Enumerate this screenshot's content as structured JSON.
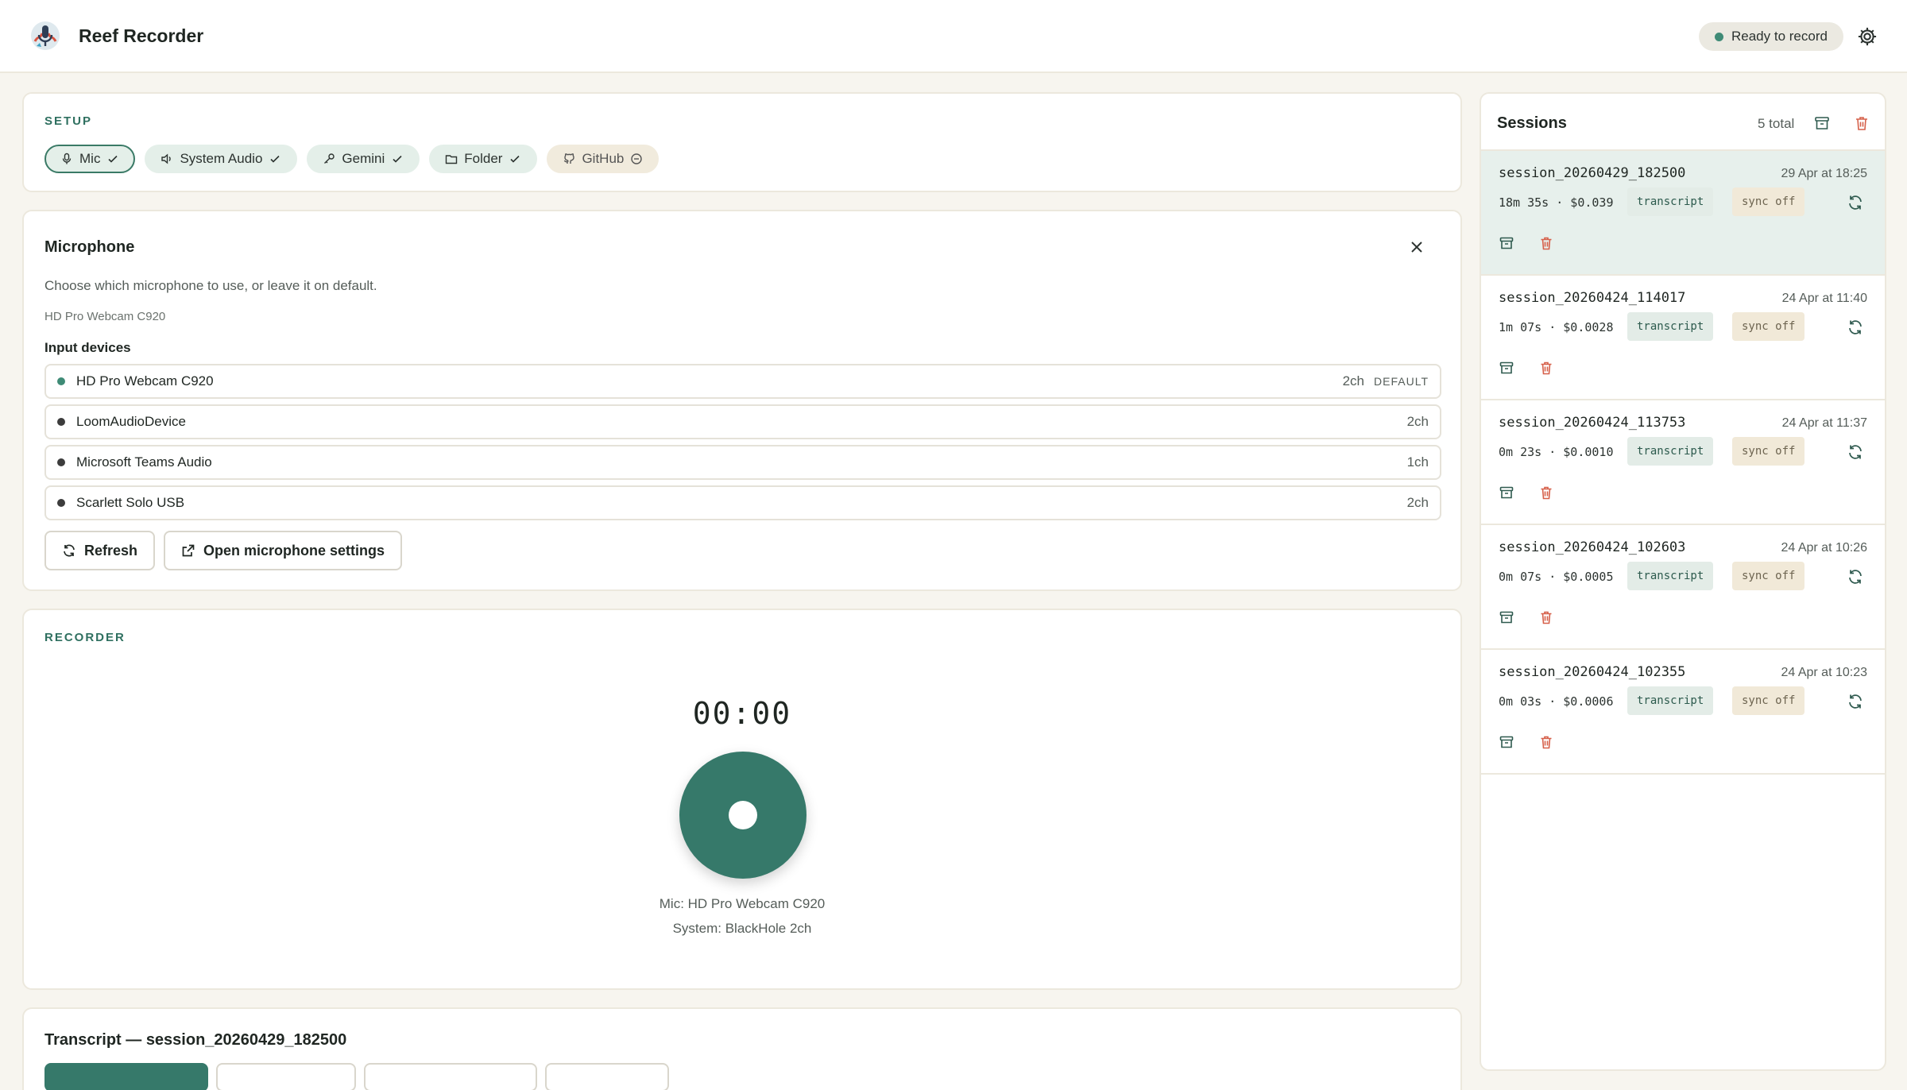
{
  "header": {
    "app_title": "Reef Recorder",
    "status": "Ready to record",
    "accent": "#36796a"
  },
  "setup": {
    "label": "SETUP",
    "chips": [
      {
        "label": "Mic",
        "icon": "mic-icon",
        "state": "check",
        "active": true
      },
      {
        "label": "System Audio",
        "icon": "speaker-icon",
        "state": "check"
      },
      {
        "label": "Gemini",
        "icon": "key-icon",
        "state": "check"
      },
      {
        "label": "Folder",
        "icon": "folder-icon",
        "state": "check"
      },
      {
        "label": "GitHub",
        "icon": "github-icon",
        "state": "minus"
      }
    ]
  },
  "microphone": {
    "title": "Microphone",
    "description": "Choose which microphone to use, or leave it on default.",
    "current": "HD Pro Webcam C920",
    "input_label": "Input devices",
    "devices": [
      {
        "name": "HD Pro Webcam C920",
        "channels": "2ch",
        "badge": "DEFAULT",
        "selected": true
      },
      {
        "name": "LoomAudioDevice",
        "channels": "2ch"
      },
      {
        "name": "Microsoft Teams Audio",
        "channels": "1ch"
      },
      {
        "name": "Scarlett Solo USB",
        "channels": "2ch"
      }
    ],
    "refresh_label": "Refresh",
    "settings_label": "Open microphone settings"
  },
  "recorder": {
    "label": "RECORDER",
    "timer": "00:00",
    "mic_line": "Mic: HD Pro Webcam C920",
    "system_line": "System: BlackHole 2ch"
  },
  "transcript": {
    "title": "Transcript — session_20260429_182500"
  },
  "sessions": {
    "title": "Sessions",
    "count": "5 total",
    "items": [
      {
        "name": "session_20260429_182500",
        "date": "29 Apr at 18:25",
        "meta": "18m 35s · $0.039",
        "tag": "transcript",
        "sync": "sync off",
        "active": true
      },
      {
        "name": "session_20260424_114017",
        "date": "24 Apr at 11:40",
        "meta": "1m 07s · $0.0028",
        "tag": "transcript",
        "sync": "sync off"
      },
      {
        "name": "session_20260424_113753",
        "date": "24 Apr at 11:37",
        "meta": "0m 23s · $0.0010",
        "tag": "transcript",
        "sync": "sync off"
      },
      {
        "name": "session_20260424_102603",
        "date": "24 Apr at 10:26",
        "meta": "0m 07s · $0.0005",
        "tag": "transcript",
        "sync": "sync off"
      },
      {
        "name": "session_20260424_102355",
        "date": "24 Apr at 10:23",
        "meta": "0m 03s · $0.0006",
        "tag": "transcript",
        "sync": "sync off"
      }
    ]
  }
}
